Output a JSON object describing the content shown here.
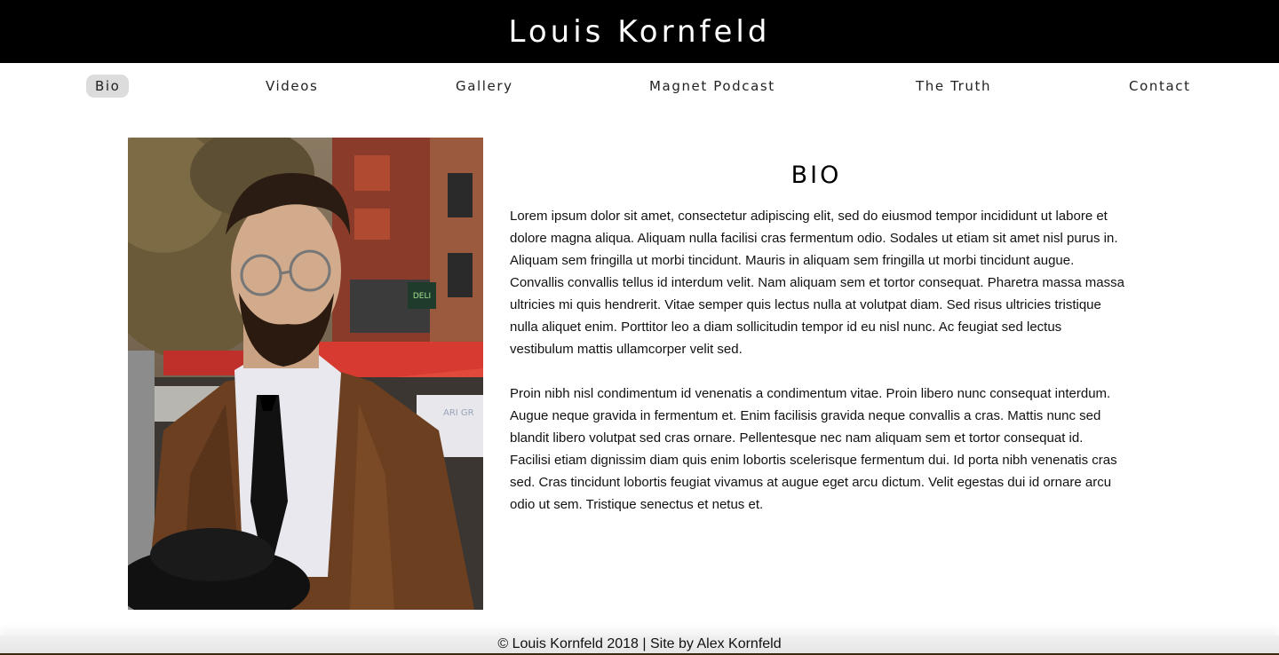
{
  "header": {
    "title": "Louis Kornfeld"
  },
  "nav": {
    "items": [
      {
        "label": "Bio",
        "active": true
      },
      {
        "label": "Videos"
      },
      {
        "label": "Gallery"
      },
      {
        "label": "Magnet Podcast"
      },
      {
        "label": "The Truth"
      },
      {
        "label": "Contact"
      }
    ]
  },
  "main": {
    "bio_heading": "BIO",
    "paragraphs": [
      "Lorem ipsum dolor sit amet, consectetur adipiscing elit, sed do eiusmod tempor incididunt ut labore et dolore magna aliqua. Aliquam nulla facilisi cras fermentum odio. Sodales ut etiam sit amet nisl purus in. Aliquam sem fringilla ut morbi tincidunt. Mauris in aliquam sem fringilla ut morbi tincidunt augue. Convallis convallis tellus id interdum velit. Nam aliquam sem et tortor consequat. Pharetra massa massa ultricies mi quis hendrerit. Vitae semper quis lectus nulla at volutpat diam. Sed risus ultricies tristique nulla aliquet enim. Porttitor leo a diam sollicitudin tempor id eu nisl nunc. Ac feugiat sed lectus vestibulum mattis ullamcorper velit sed.",
      "Proin nibh nisl condimentum id venenatis a condimentum vitae. Proin libero nunc consequat interdum. Augue neque gravida in fermentum et. Enim facilisis gravida neque convallis a cras. Mattis nunc sed blandit libero volutpat sed cras ornare. Pellentesque nec nam aliquam sem et tortor consequat id. Facilisi etiam dignissim diam quis enim lobortis scelerisque fermentum dui. Id porta nibh venenatis cras sed. Cras tincidunt lobortis feugiat vivamus at augue eget arcu dictum. Velit egestas dui id ornare arcu odio ut sem. Tristique senectus et netus et."
    ]
  },
  "photo_sign_texts": [
    "DELI",
    "ARI GR"
  ],
  "footer": {
    "text": "© Louis Kornfeld 2018 | Site by Alex Kornfeld"
  },
  "colors": {
    "header_bg": "#000000",
    "active_nav_bg": "#dcdcdc",
    "footer_bg": "#e6e6e6"
  }
}
